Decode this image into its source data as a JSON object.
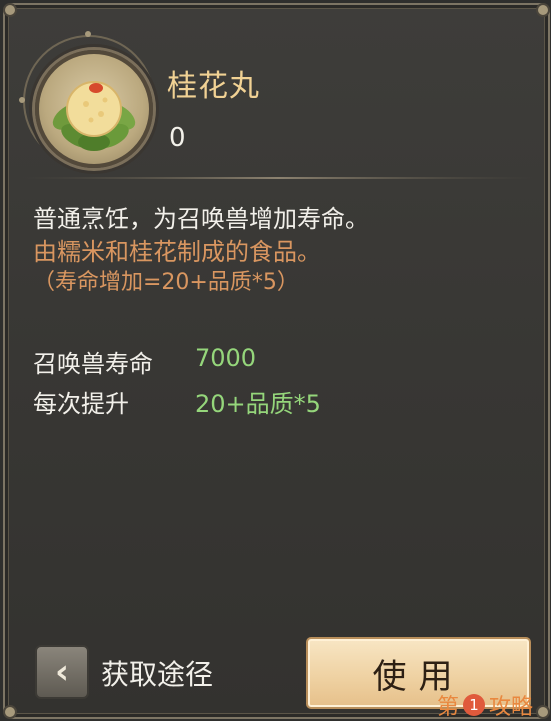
{
  "item": {
    "name": "桂花丸",
    "count": "0",
    "icon": "rice-ball-icon"
  },
  "description": {
    "line1": "普通烹饪，为召唤兽增加寿命。",
    "line2": "由糯米和桂花制成的食品。",
    "line3": "（寿命增加=20+品质*5）"
  },
  "stats": [
    {
      "label": "召唤兽寿命",
      "value": "7000"
    },
    {
      "label": "每次提升",
      "value": "20+品质*5"
    }
  ],
  "footer": {
    "back_icon": "chevron-left-icon",
    "source_label": "获取途径",
    "use_label": "使用"
  },
  "watermark": {
    "prefix": "第",
    "number": "1",
    "suffix": "攻略"
  },
  "colors": {
    "title": "#f1d294",
    "orange_text": "#d99660",
    "green_value": "#95d67b"
  }
}
